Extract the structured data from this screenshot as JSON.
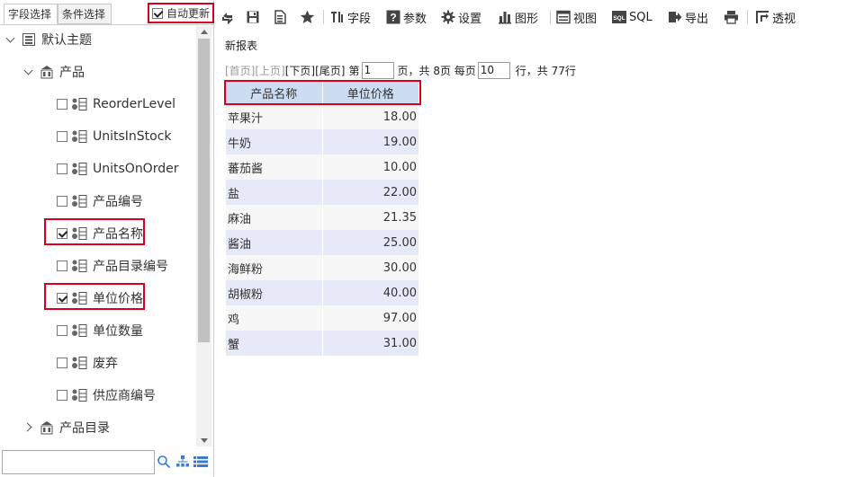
{
  "tabs": {
    "field_select": "字段选择",
    "condition_select": "条件选择",
    "auto_update": "自动更新"
  },
  "tree": {
    "root": "默认主题",
    "product_table": "产品",
    "fields": [
      {
        "label": "ReorderLevel",
        "checked": false
      },
      {
        "label": "UnitsInStock",
        "checked": false
      },
      {
        "label": "UnitsOnOrder",
        "checked": false
      },
      {
        "label": "产品编号",
        "checked": false
      },
      {
        "label": "产品名称",
        "checked": true
      },
      {
        "label": "产品目录编号",
        "checked": false
      },
      {
        "label": "单位价格",
        "checked": true
      },
      {
        "label": "单位数量",
        "checked": false
      },
      {
        "label": "废弃",
        "checked": false
      },
      {
        "label": "供应商编号",
        "checked": false
      }
    ],
    "catalog_table": "产品目录"
  },
  "search": {
    "placeholder": ""
  },
  "toolbar": {
    "field": "字段",
    "param": "参数",
    "settings": "设置",
    "chart": "图形",
    "view": "视图",
    "sql": "SQL",
    "export": "导出",
    "pivot": "透视"
  },
  "report": {
    "title": "新报表",
    "pager": {
      "first": "[首页]",
      "prev": "[上页]",
      "next": "[下页]",
      "last": "[尾页]",
      "page_prefix": "第",
      "current_page": "1",
      "page_suffix": "页，共 8页 每页",
      "page_size": "10",
      "rows_suffix": "行，共 77行"
    },
    "columns": [
      "产品名称",
      "单位价格"
    ],
    "rows": [
      [
        "苹果汁",
        "18.00"
      ],
      [
        "牛奶",
        "19.00"
      ],
      [
        "蕃茄酱",
        "10.00"
      ],
      [
        "盐",
        "22.00"
      ],
      [
        "麻油",
        "21.35"
      ],
      [
        "酱油",
        "25.00"
      ],
      [
        "海鲜粉",
        "30.00"
      ],
      [
        "胡椒粉",
        "40.00"
      ],
      [
        "鸡",
        "97.00"
      ],
      [
        "蟹",
        "31.00"
      ]
    ]
  },
  "colors": {
    "highlight": "#d9001b",
    "header_bg": "#ccdcf1",
    "row_alt": "#e6eaf8"
  }
}
